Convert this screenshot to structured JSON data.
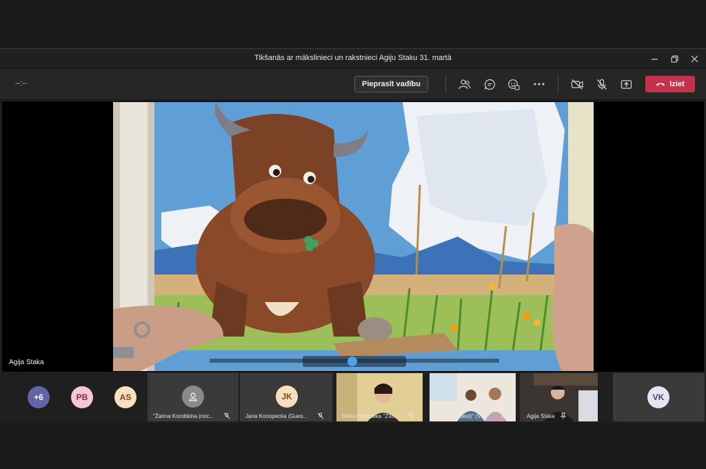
{
  "window": {
    "title": "Tikšanās ar mākslinieci un rakstnieci Agiju Staku 31. martā"
  },
  "toolbar": {
    "timer": "--:--",
    "request_control_label": "Pieprasīt vadību",
    "leave_label": "Iziet",
    "icons": [
      "people-icon",
      "chat-icon",
      "reactions-icon",
      "more-options-icon",
      "camera-off-icon",
      "mic-off-icon",
      "share-tray-icon",
      "phone-hangup-icon"
    ]
  },
  "stage": {
    "presenter_name": "Agija Staka"
  },
  "participants": {
    "overflow_count": "+6",
    "avatars": [
      {
        "initials": "PB",
        "bg": "#f4c6d6",
        "fg": "#7a2b4a"
      },
      {
        "initials": "AS",
        "bg": "#f8dfc0",
        "fg": "#7a4a1b"
      }
    ],
    "tiles": [
      {
        "name": "\"Žanna Korobkina (noc...",
        "kind": "generic-avatar"
      },
      {
        "name": "Jana Konopecka (Gues...",
        "kind": "initials",
        "initials": "JK"
      },
      {
        "name": "Bērnu bibliotēka \"Zīlīte",
        "kind": "video"
      },
      {
        "name": "\"12.p.i. (Guest)\" (Vi...",
        "kind": "video"
      },
      {
        "name": "Agija Staka",
        "kind": "video"
      }
    ],
    "last_tile_initials": "VK"
  },
  "colors": {
    "leave_red": "#c4314b",
    "overflow_purple": "#6264a7",
    "bar_bg": "#262626"
  }
}
